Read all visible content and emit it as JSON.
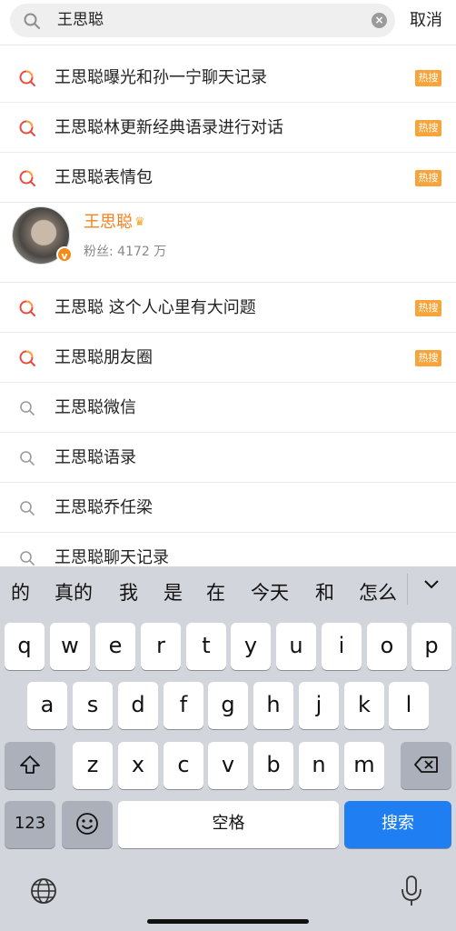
{
  "search": {
    "query": "王思聪",
    "cancel_label": "取消"
  },
  "suggestions_top": [
    {
      "label": "王思聪曝光和孙一宁聊天记录",
      "badge": "热搜",
      "icon": "hot-search-icon"
    },
    {
      "label": "王思聪林更新经典语录进行对话",
      "badge": "热搜",
      "icon": "hot-search-icon"
    },
    {
      "label": "王思聪表情包",
      "badge": "热搜",
      "icon": "hot-search-icon"
    }
  ],
  "user": {
    "name": "王思聪",
    "fans": "粉丝: 4172 万",
    "verified_mark": "v"
  },
  "suggestions_bottom": [
    {
      "label": "王思聪 这个人心里有大问题",
      "badge": "热搜",
      "icon": "hot-search-icon"
    },
    {
      "label": "王思聪朋友圈",
      "badge": "热搜",
      "icon": "hot-search-icon"
    },
    {
      "label": "王思聪微信",
      "badge": "",
      "icon": "search-icon"
    },
    {
      "label": "王思聪语录",
      "badge": "",
      "icon": "search-icon"
    },
    {
      "label": "王思聪乔任梁",
      "badge": "",
      "icon": "search-icon"
    },
    {
      "label": "王思聪聊天记录",
      "badge": "",
      "icon": "search-icon"
    }
  ],
  "candidates": [
    "的",
    "真的",
    "我",
    "是",
    "在",
    "今天",
    "和",
    "怎么"
  ],
  "keyboard": {
    "row1": [
      "q",
      "w",
      "e",
      "r",
      "t",
      "y",
      "u",
      "i",
      "o",
      "p"
    ],
    "row2": [
      "a",
      "s",
      "d",
      "f",
      "g",
      "h",
      "j",
      "k",
      "l"
    ],
    "row3": [
      "z",
      "x",
      "c",
      "v",
      "b",
      "n",
      "m"
    ],
    "num_label": "123",
    "space_label": "空格",
    "search_label": "搜索"
  },
  "colors": {
    "accent_orange": "#f4811e",
    "badge": "#f7a43a",
    "key_blue": "#1f7ef2"
  }
}
